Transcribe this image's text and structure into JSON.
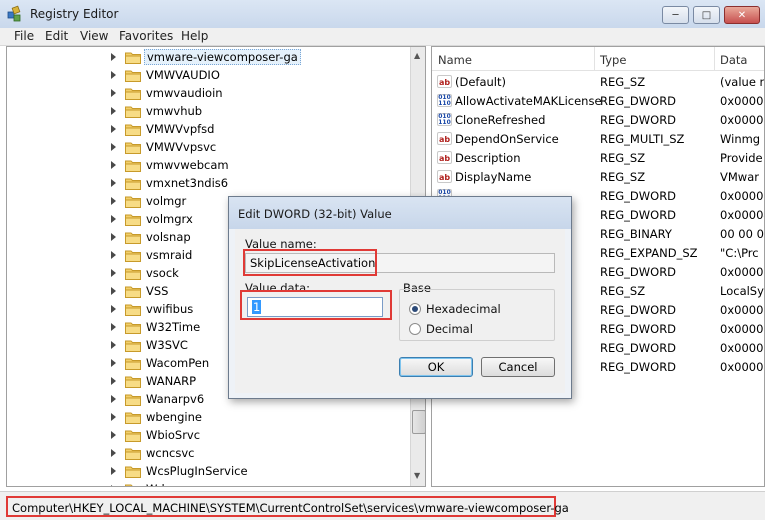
{
  "window": {
    "title": "Registry Editor",
    "app_icon": "registry-cubes-icon",
    "controls": [
      "minimize-icon",
      "maximize-icon",
      "close-icon"
    ]
  },
  "menu": [
    "File",
    "Edit",
    "View",
    "Favorites",
    "Help"
  ],
  "tree": {
    "items": [
      "vmware-viewcomposer-ga",
      "VMWVAUDIO",
      "vmwvaudioin",
      "vmwvhub",
      "VMWVvpfsd",
      "VMWVvpsvc",
      "vmwvwebcam",
      "vmxnet3ndis6",
      "volmgr",
      "volmgrx",
      "volsnap",
      "vsmraid",
      "vsock",
      "VSS",
      "vwifibus",
      "W32Time",
      "W3SVC",
      "WacomPen",
      "WANARP",
      "Wanarpv6",
      "wbengine",
      "WbioSrvc",
      "wcncsvc",
      "WcsPlugInService",
      "Wd"
    ],
    "selected_index": 0
  },
  "list": {
    "columns": [
      "Name",
      "Type",
      "Data"
    ],
    "rows": [
      {
        "icon": "sz",
        "name": "(Default)",
        "type": "REG_SZ",
        "data": "(value n"
      },
      {
        "icon": "bin",
        "name": "AllowActivateMAKLicense",
        "type": "REG_DWORD",
        "data": "0x00000"
      },
      {
        "icon": "bin",
        "name": "CloneRefreshed",
        "type": "REG_DWORD",
        "data": "0x00000"
      },
      {
        "icon": "sz",
        "name": "DependOnService",
        "type": "REG_MULTI_SZ",
        "data": "Winmg"
      },
      {
        "icon": "sz",
        "name": "Description",
        "type": "REG_SZ",
        "data": "Provide"
      },
      {
        "icon": "sz",
        "name": "DisplayName",
        "type": "REG_SZ",
        "data": "VMwar"
      },
      {
        "icon": "bin",
        "name": "",
        "type": "REG_DWORD",
        "data": "0x00000"
      },
      {
        "icon": "bin",
        "name": "",
        "type": "REG_DWORD",
        "data": "0x00004"
      },
      {
        "icon": "bin",
        "name": "",
        "type": "REG_BINARY",
        "data": "00 00 0"
      },
      {
        "icon": "sz",
        "name": "",
        "type": "REG_EXPAND_SZ",
        "data": "\"C:\\Prc"
      },
      {
        "icon": "bin",
        "name": "",
        "type": "REG_DWORD",
        "data": "0x00000"
      },
      {
        "icon": "sz",
        "name": "",
        "type": "REG_SZ",
        "data": "LocalSy"
      },
      {
        "icon": "bin",
        "name": "",
        "type": "REG_DWORD",
        "data": "0x00000"
      },
      {
        "icon": "bin",
        "name": "",
        "type": "REG_DWORD",
        "data": "0x00000"
      },
      {
        "icon": "bin",
        "name": "",
        "type": "REG_DWORD",
        "data": "0x00000"
      },
      {
        "icon": "bin",
        "name": "",
        "type": "REG_DWORD",
        "data": "0x00000"
      }
    ]
  },
  "status": {
    "path": "Computer\\HKEY_LOCAL_MACHINE\\SYSTEM\\CurrentControlSet\\services\\vmware-viewcomposer-ga"
  },
  "dialog": {
    "title": "Edit DWORD (32-bit) Value",
    "value_name_label": "Value name:",
    "value_name": "SkipLicenseActivation",
    "value_data_label": "Value data:",
    "value_data": "1",
    "base_label": "Base",
    "base_options": [
      "Hexadecimal",
      "Decimal"
    ],
    "base_selected": "Hexadecimal",
    "ok_label": "OK",
    "cancel_label": "Cancel"
  },
  "colors": {
    "highlight": "#e03a36",
    "title_bar": "#c9d8ec"
  }
}
